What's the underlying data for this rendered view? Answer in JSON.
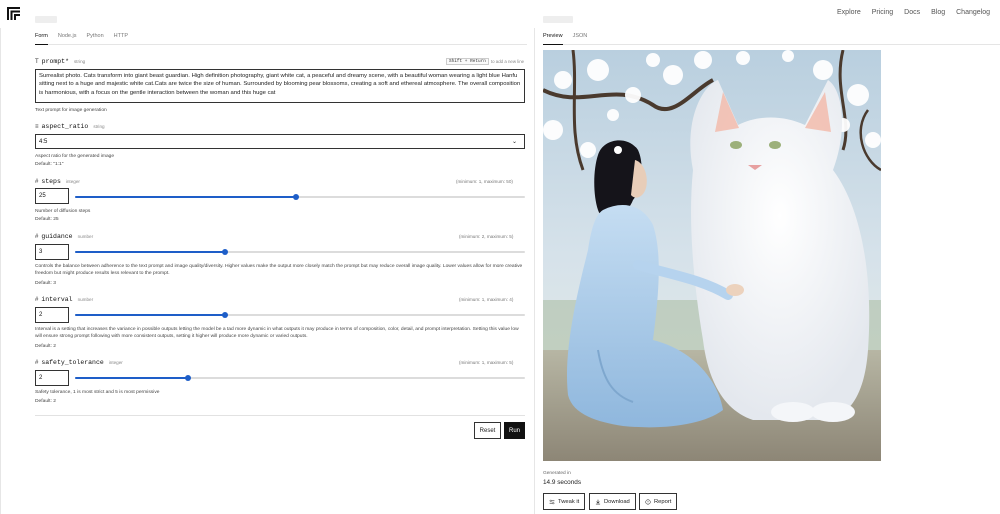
{
  "nav": {
    "items": [
      "Explore",
      "Pricing",
      "Docs",
      "Blog",
      "Changelog"
    ]
  },
  "left_tabs": [
    "Form",
    "Node.js",
    "Python",
    "HTTP"
  ],
  "right_tabs": [
    "Preview",
    "JSON"
  ],
  "prompt": {
    "name": "prompt*",
    "type": "string",
    "hint_keys": "Shift + Return",
    "hint_text": "to add a new line",
    "value": "Surrealist photo.  Cats transform into giant beast guardian.  High definition photography,  giant white cat, a peaceful and dreamy scene, with a beautiful woman wearing a light blue Hanfu sitting next to a huge and majestic white cat.Cats are twice the size of human.   Surrounded by blooming pear blossoms, creating a soft and ethereal atmosphere. The overall composition is harmonious, with a focus on the gentle interaction between the woman and this huge cat",
    "description": "Text prompt for image generation"
  },
  "aspect_ratio": {
    "name": "aspect_ratio",
    "type": "string",
    "value": "4:5",
    "description": "Aspect ratio for the generated image",
    "default": "Default: \"1:1\""
  },
  "steps": {
    "name": "steps",
    "type": "integer",
    "range": "(minimum: 1, maximum: 50)",
    "value": "25",
    "slider_fraction": 0.49,
    "description": "Number of diffusion steps",
    "default": "Default: 25"
  },
  "guidance": {
    "name": "guidance",
    "type": "number",
    "range": "(minimum: 2, maximum: 5)",
    "value": "3",
    "slider_fraction": 0.333,
    "description": "Controls the balance between adherence to the text prompt and image quality/diversity. Higher values make the output more closely match the prompt but may reduce overall image quality. Lower values allow for more creative freedom but might produce results less relevant to the prompt.",
    "default": "Default: 3"
  },
  "interval": {
    "name": "interval",
    "type": "number",
    "range": "(minimum: 1, maximum: 4)",
    "value": "2",
    "slider_fraction": 0.333,
    "description": "Interval is a setting that increases the variance in possible outputs letting the model be a tad more dynamic in what outputs it may produce in terms of composition, color, detail, and prompt interpretation. Setting this value low will ensure strong prompt following with more consistent outputs, setting it higher will produce more dynamic or varied outputs.",
    "default": "Default: 2"
  },
  "safety_tolerance": {
    "name": "safety_tolerance",
    "type": "integer",
    "range": "(minimum: 1, maximum: 5)",
    "value": "2",
    "slider_fraction": 0.25,
    "description": "Safety tolerance, 1 is most strict and 5 is most permissive",
    "default": "Default: 2"
  },
  "form_buttons": {
    "reset": "Reset",
    "run": "Run"
  },
  "output": {
    "generated_label": "Generated in",
    "generated_time": "14.9 seconds",
    "tweak": "Tweak it",
    "download": "Download",
    "report": "Report"
  },
  "colors": {
    "accent": "#1e5ec8",
    "run_bg": "#111111"
  }
}
